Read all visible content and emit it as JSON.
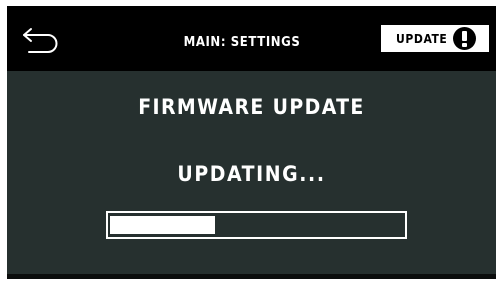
{
  "header": {
    "back_icon": "back-arrow-icon",
    "title": "MAIN: SETTINGS",
    "update_label": "UPDATE",
    "update_icon": "exclamation-circle-icon"
  },
  "main": {
    "heading": "FIRMWARE UPDATE",
    "status": "UPDATING...",
    "progress_fraction": 0.36
  },
  "colors": {
    "background": "#26302f",
    "topbar": "#000000",
    "text": "#ffffff"
  }
}
